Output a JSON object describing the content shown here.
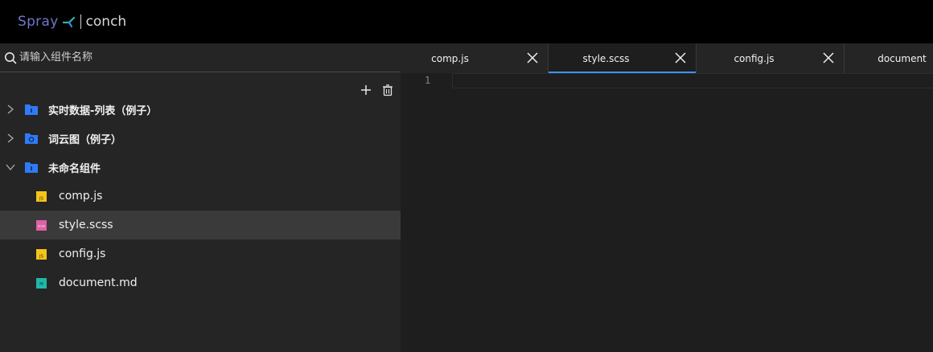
{
  "app": {
    "brand": "Spray",
    "product": "conch"
  },
  "search": {
    "placeholder": "请输入组件名称"
  },
  "tree": {
    "folders": [
      {
        "label": "实时数据-列表（例子）",
        "expanded": false
      },
      {
        "label": "词云图（例子）",
        "expanded": false
      },
      {
        "label": "未命名组件",
        "expanded": true
      }
    ],
    "files": [
      {
        "label": "comp.js",
        "type": "JS"
      },
      {
        "label": "style.scss",
        "type": "SCSS",
        "selected": true
      },
      {
        "label": "config.js",
        "type": "JS"
      },
      {
        "label": "document.md",
        "type": "MD"
      }
    ]
  },
  "tabs": [
    {
      "label": "comp.js"
    },
    {
      "label": "style.scss",
      "active": true
    },
    {
      "label": "config.js"
    },
    {
      "label": "document"
    }
  ],
  "editor": {
    "line_numbers": [
      "1"
    ]
  },
  "colors": {
    "accent": "#3794ff",
    "folder": "#2f7bf5",
    "js_icon": "#f5c518",
    "scss_icon": "#e05fa6",
    "md_icon": "#1fb8a8",
    "brand_spray": "#6e78c8"
  }
}
